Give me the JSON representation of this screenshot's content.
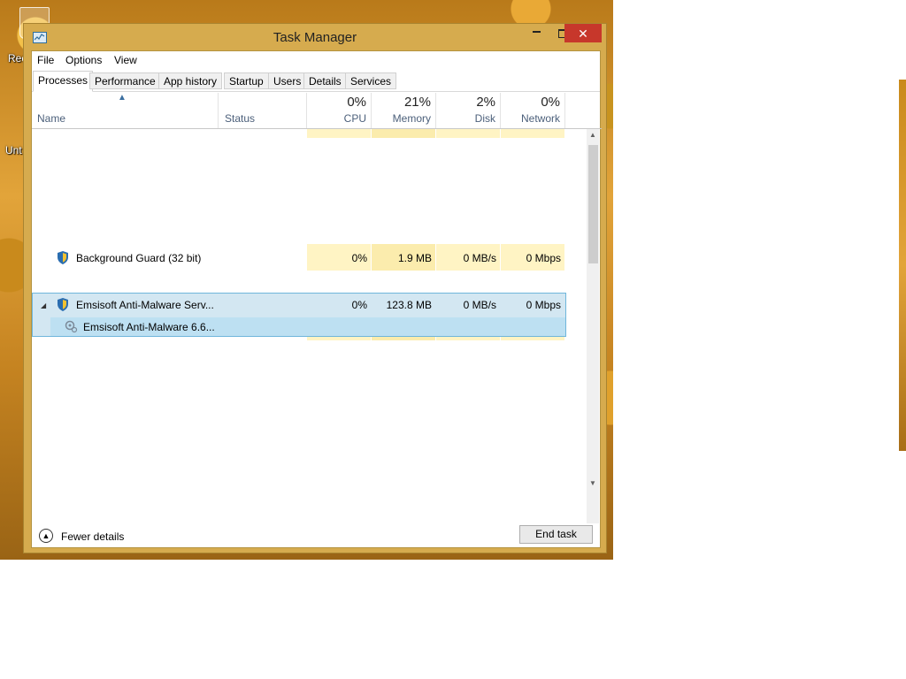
{
  "desktop": {
    "labels": [
      "Rec",
      "Unt"
    ]
  },
  "window": {
    "title": "Task Manager",
    "controls": {
      "minimize": "−",
      "maximize": "□",
      "close": "✕"
    }
  },
  "menu": [
    "File",
    "Options",
    "View"
  ],
  "tabs": [
    "Processes",
    "Performance",
    "App history",
    "Startup",
    "Users",
    "Details",
    "Services"
  ],
  "columns": {
    "name": "Name",
    "status": "Status",
    "cpu": {
      "pct": "0%",
      "label": "CPU"
    },
    "memory": {
      "pct": "21%",
      "label": "Memory"
    },
    "disk": {
      "pct": "2%",
      "label": "Disk"
    },
    "network": {
      "pct": "0%",
      "label": "Network"
    }
  },
  "processes": [
    {
      "name": "Background Guard (32 bit)",
      "cpu": "0%",
      "memory": "1.9 MB",
      "disk": "0 MB/s",
      "network": "0 Mbps",
      "icon": "shield-icon"
    },
    {
      "name": "Emsisoft Anti-Malware Serv...",
      "cpu": "0%",
      "memory": "123.8 MB",
      "disk": "0 MB/s",
      "network": "0 Mbps",
      "icon": "shield-icon",
      "expanded": true,
      "selected": true,
      "children": [
        {
          "name": "Emsisoft Anti-Malware 6.6...",
          "icon": "gear-icon"
        }
      ]
    }
  ],
  "footer": {
    "fewer_details": "Fewer details",
    "end_task": "End task"
  },
  "colors": {
    "frame": "#d6ab4e",
    "close": "#c7372b",
    "selection": "#d3e7f2",
    "heat_light": "#fff4c4"
  }
}
